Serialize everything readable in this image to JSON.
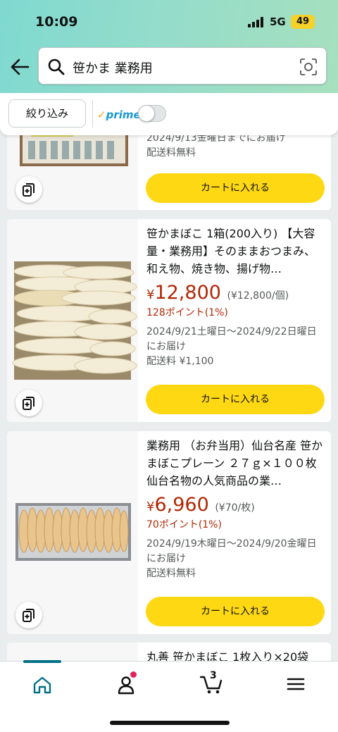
{
  "status_bar": {
    "time": "10:09",
    "network": "5G",
    "battery": "49"
  },
  "search": {
    "query": "笹かま 業務用"
  },
  "filters": {
    "refine_label": "絞り込み",
    "prime_label": "prime",
    "prime_check": "✓"
  },
  "products": [
    {
      "delivery": "2024/9/13金曜日までにお届け",
      "shipping": "配送料無料",
      "cart_label": "カートに入れる"
    },
    {
      "title": "笹かまぼこ 1箱(200入り) 【大容量・業務用】そのままおつまみ、和え物、焼き物、揚げ物…",
      "price_symbol": "¥",
      "price": "12,800",
      "unit_price": "(¥12,800/個)",
      "points": "128ポイント(1%)",
      "delivery": "2024/9/21土曜日～2024/9/22日曜日 にお届け",
      "shipping": "配送料 ¥1,100",
      "cart_label": "カートに入れる"
    },
    {
      "title": "業務用 （お弁当用）仙台名産 笹かまぼこプレーン ２７ｇ×１００枚 仙台名物の人気商品の業…",
      "price_symbol": "¥",
      "price": "6,960",
      "unit_price": "(¥70/枚)",
      "points": "70ポイント(1%)",
      "delivery": "2024/9/19木曜日～2024/9/20金曜日 にお届け",
      "shipping": "配送料無料",
      "cart_label": "カートに入れる"
    },
    {
      "title": "丸善 笹かまぼこ 1枚入り×20袋"
    }
  ],
  "nav": {
    "cart_count": "3"
  }
}
